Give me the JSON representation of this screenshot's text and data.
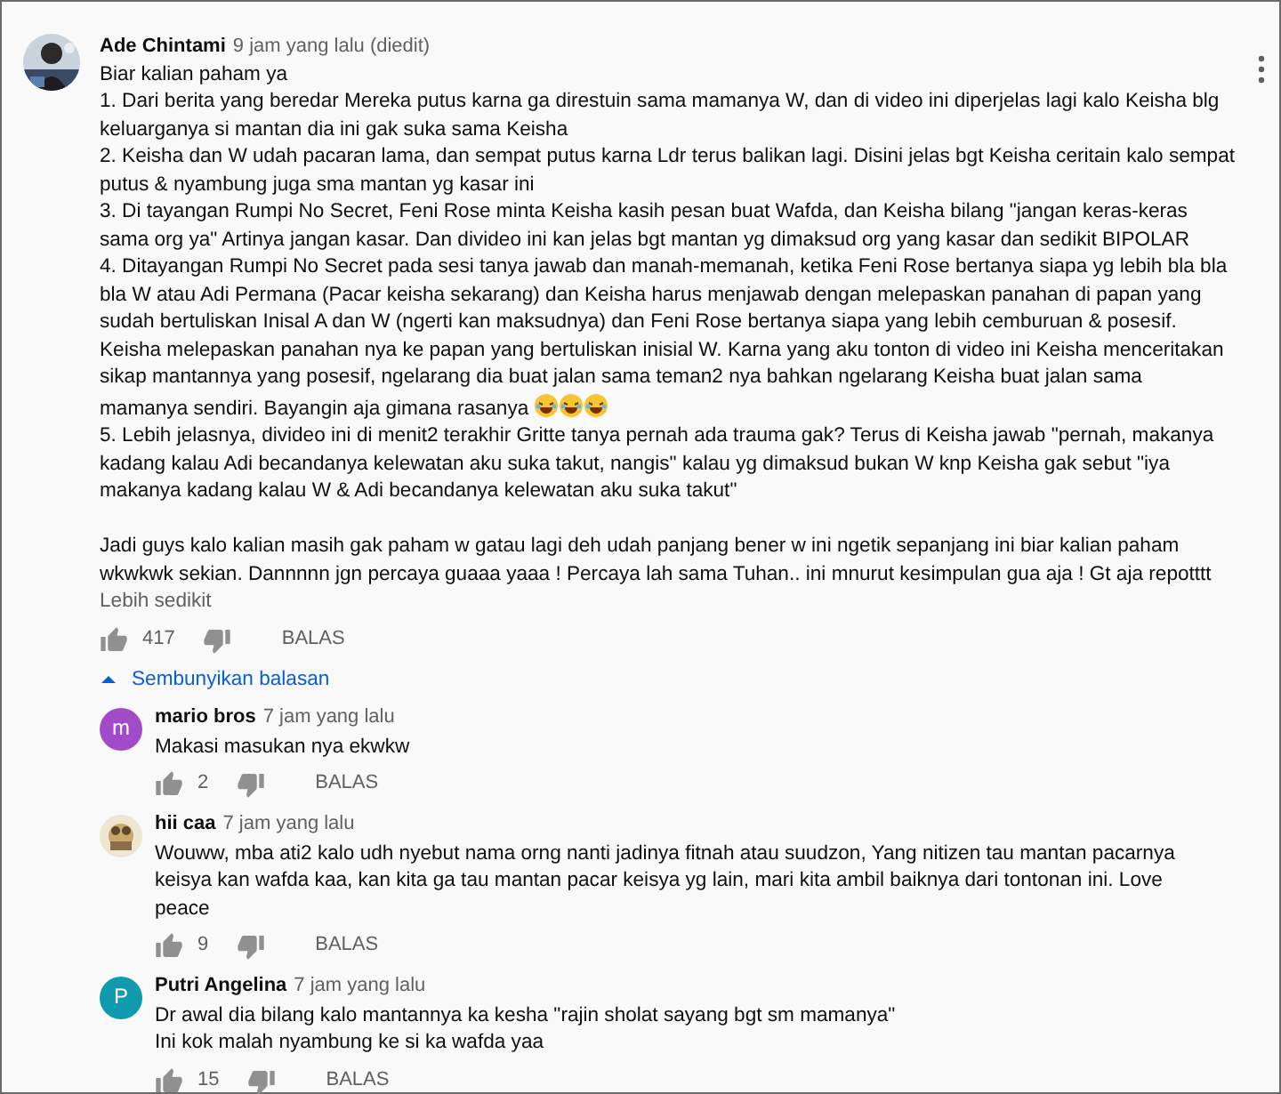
{
  "comment": {
    "author": "Ade Chintami",
    "time": "9 jam yang lalu (diedit)",
    "avatar": {
      "kind": "picture"
    },
    "paragraphs": [
      "Biar kalian paham ya",
      "1. Dari berita yang beredar Mereka putus karna ga direstuin sama mamanya W, dan di video ini diperjelas lagi kalo Keisha blg keluarganya si mantan dia ini gak suka sama Keisha",
      "2. Keisha dan W udah pacaran lama, dan sempat putus karna Ldr terus balikan lagi. Disini jelas bgt Keisha ceritain kalo sempat putus & nyambung juga sma mantan yg kasar ini",
      "3. Di tayangan Rumpi No Secret, Feni Rose minta Keisha kasih pesan buat Wafda, dan Keisha bilang \"jangan keras-keras sama org ya\" Artinya jangan kasar. Dan divideo ini kan jelas bgt mantan yg dimaksud org yang kasar dan sedikit BIPOLAR",
      "4. Ditayangan Rumpi No Secret pada sesi tanya jawab dan manah-memanah, ketika Feni Rose bertanya siapa yg lebih bla bla bla W atau Adi Permana (Pacar keisha sekarang) dan Keisha harus menjawab dengan melepaskan panahan di papan yang sudah bertuliskan Inisal A dan W (ngerti kan maksudnya) dan Feni Rose bertanya siapa yang lebih cemburuan & posesif. Keisha melepaskan panahan nya ke papan yang bertuliskan inisial W. Karna yang aku tonton di video ini Keisha menceritakan sikap mantannya yang posesif, ngelarang dia buat jalan sama teman2 nya bahkan ngelarang Keisha buat jalan sama mamanya sendiri. Bayangin aja gimana rasanya",
      "5. Lebih jelasnya, divideo ini di menit2 terakhir Gritte tanya pernah ada trauma gak? Terus di Keisha jawab \"pernah, makanya kadang kalau Adi becandanya kelewatan aku suka takut, nangis\" kalau yg dimaksud bukan W knp Keisha gak sebut \"iya makanya kadang kalau W & Adi becandanya kelewatan aku suka takut\"",
      "Jadi guys kalo kalian masih gak paham w gatau lagi deh udah panjang bener w ini ngetik sepanjang ini biar kalian paham wkwkwk sekian. Dannnnn jgn percaya guaaa yaaa ! Percaya lah sama Tuhan.. ini mnurut kesimpulan gua aja ! Gt aja repotttt"
    ],
    "less_link": "Lebih sedikit",
    "likes": "417",
    "reply": "BALAS"
  },
  "toggle": {
    "label": "Sembunyikan balasan",
    "expanded": true
  },
  "replies": [
    {
      "author": "mario bros",
      "time": "7 jam yang lalu",
      "avatar": {
        "kind": "letter",
        "letter": "m",
        "color": "#a24ac8"
      },
      "lines": [
        "Makasi masukan nya ekwkw"
      ],
      "likes": "2",
      "reply": "BALAS"
    },
    {
      "author": "hii caa",
      "time": "7 jam yang lalu",
      "avatar": {
        "kind": "picture"
      },
      "lines": [
        "Wouww, mba ati2 kalo udh nyebut nama orng nanti jadinya fitnah atau suudzon, Yang nitizen tau mantan pacarnya keisya kan wafda kaa, kan kita ga tau mantan pacar keisya yg lain, mari kita ambil baiknya dari tontonan ini. Love peace"
      ],
      "likes": "9",
      "reply": "BALAS"
    },
    {
      "author": "Putri Angelina",
      "time": "7 jam yang lalu",
      "avatar": {
        "kind": "letter",
        "letter": "P",
        "color": "#0f9bad"
      },
      "lines": [
        "Dr awal dia bilang kalo mantannya ka kesha \"rajin sholat sayang bgt sm mamanya\"",
        "Ini kok malah nyambung ke si ka wafda yaa"
      ],
      "likes": "15",
      "reply": "BALAS"
    }
  ]
}
